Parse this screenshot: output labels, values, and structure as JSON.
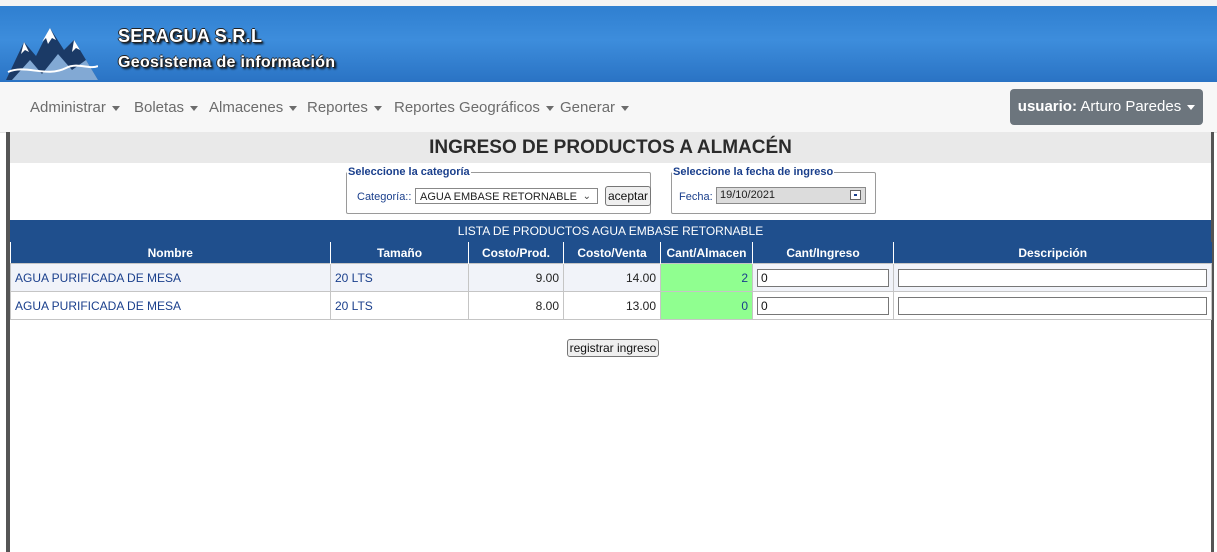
{
  "header": {
    "company": "SERAGUA S.R.L",
    "subtitle": "Geosistema de información"
  },
  "nav": {
    "items": [
      {
        "label": "Administrar"
      },
      {
        "label": "Boletas"
      },
      {
        "label": "Almacenes"
      },
      {
        "label": "Reportes"
      },
      {
        "label": "Reportes Geográficos"
      },
      {
        "label": "Generar"
      }
    ],
    "user_prefix": "usuario:",
    "user_name": "Arturo Paredes"
  },
  "page": {
    "title": "INGRESO DE PRODUCTOS A ALMACÉN"
  },
  "category": {
    "legend": "Seleccione la categoría",
    "label": "Categoría::",
    "selected": "AGUA EMBASE RETORNABLE",
    "accept_label": "aceptar"
  },
  "date": {
    "legend": "Seleccione la fecha de ingreso",
    "label": "Fecha:",
    "value": "19/10/2021"
  },
  "table": {
    "list_title": "LISTA DE PRODUCTOS AGUA EMBASE RETORNABLE",
    "headers": [
      "Nombre",
      "Tamaño",
      "Costo/Prod.",
      "Costo/Venta",
      "Cant/Almacen",
      "Cant/Ingreso",
      "Descripción"
    ],
    "rows": [
      {
        "nombre": "AGUA PURIFICADA DE MESA",
        "tamano": "20 LTS",
        "costo_prod": "9.00",
        "costo_venta": "14.00",
        "cant_almacen": "2",
        "cant_ingreso": "0",
        "descripcion": ""
      },
      {
        "nombre": "AGUA PURIFICADA DE MESA",
        "tamano": "20 LTS",
        "costo_prod": "8.00",
        "costo_venta": "13.00",
        "cant_almacen": "0",
        "cant_ingreso": "0",
        "descripcion": ""
      }
    ]
  },
  "actions": {
    "register_label": "registrar ingreso"
  },
  "colors": {
    "banner": "#2f7fd0",
    "table_header": "#1f4f8d",
    "stock_cell": "#90ff90",
    "user_button": "#6c757d"
  }
}
